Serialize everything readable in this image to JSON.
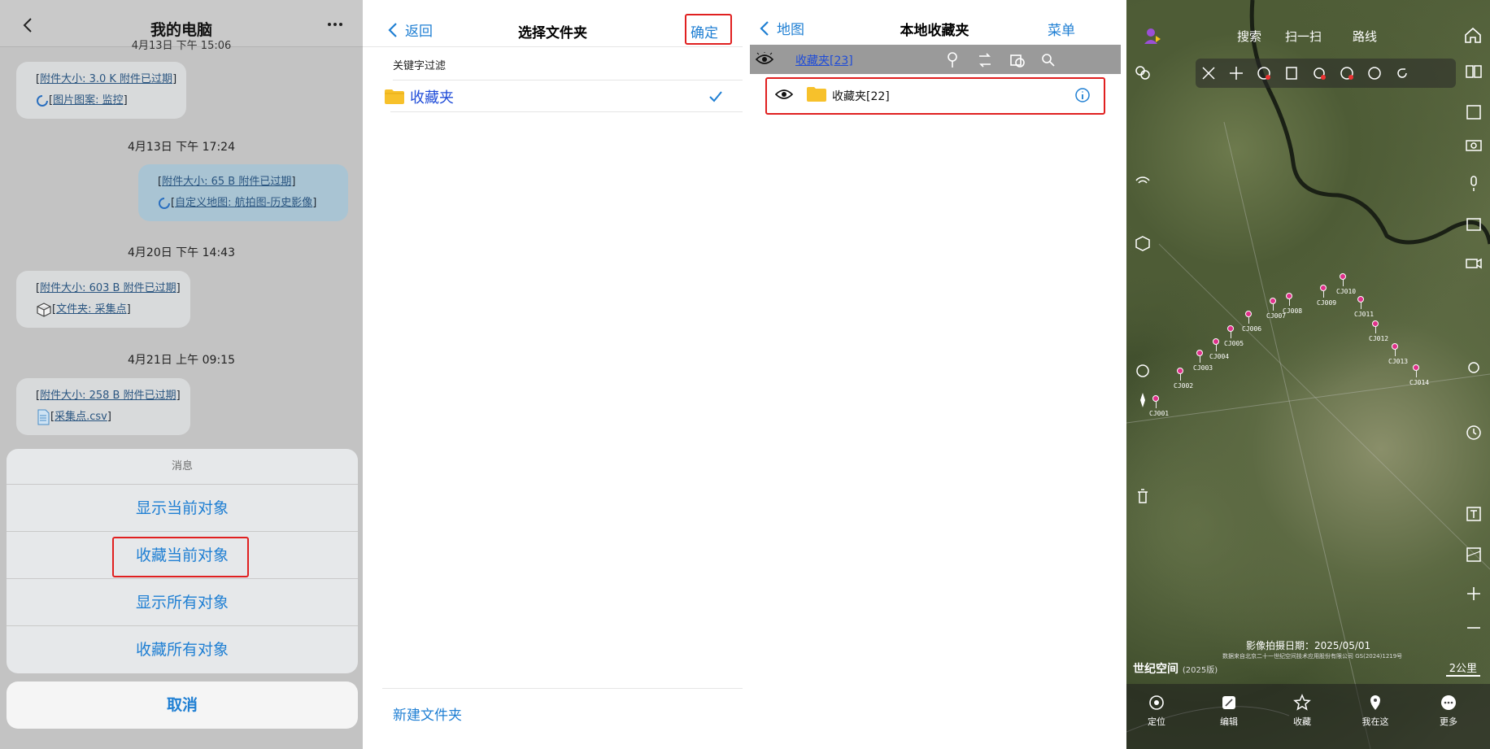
{
  "panel1": {
    "title": "我的电脑",
    "top_fragment": "4月13日 下午 15:06",
    "messages": [
      {
        "line1": "附件大小: 3.0 K 附件已过期",
        "line2": "图片图案: 监控"
      },
      {
        "timestamp": "4月13日 下午 17:24",
        "line1": "附件大小: 65 B 附件已过期",
        "line2": "自定义地图: 航拍图-历史影像"
      },
      {
        "timestamp": "4月20日 下午 14:43",
        "line1": "附件大小: 603 B 附件已过期",
        "line2": "文件夹: 采集点"
      },
      {
        "timestamp": "4月21日 上午 09:15",
        "line1": "附件大小: 258 B 附件已过期",
        "line2": "采集点.csv"
      }
    ],
    "sheet": {
      "header": "消息",
      "items": [
        "显示当前对象",
        "收藏当前对象",
        "显示所有对象",
        "收藏所有对象"
      ],
      "cancel": "取消"
    }
  },
  "panel2": {
    "back": "返回",
    "title": "选择文件夹",
    "confirm": "确定",
    "filter": "关键字过滤",
    "folder": "收藏夹",
    "new_folder": "新建文件夹"
  },
  "panel3": {
    "back": "地图",
    "title": "本地收藏夹",
    "menu": "菜单",
    "root_folder": "收藏夹[23]",
    "sub_folder": "收藏夹[22]"
  },
  "panel4": {
    "top_menu": [
      "搜索",
      "扫一扫",
      "路线"
    ],
    "pin_labels": [
      "CJ001",
      "CJ002",
      "CJ003",
      "CJ004",
      "CJ005",
      "CJ006",
      "CJ007",
      "CJ008",
      "CJ009",
      "CJ010",
      "CJ011",
      "CJ012",
      "CJ013",
      "CJ014"
    ],
    "capture_date": "影像拍摄日期：2025/05/01",
    "copyright": "数据来自北京二十一世纪空间技术应用股份有限公司 GS(2024)1219号",
    "logo": "世纪空间",
    "logo_sub": "(2025版)",
    "scale": "2公里",
    "bottom": [
      "定位",
      "编辑",
      "收藏",
      "我在这",
      "更多"
    ]
  }
}
